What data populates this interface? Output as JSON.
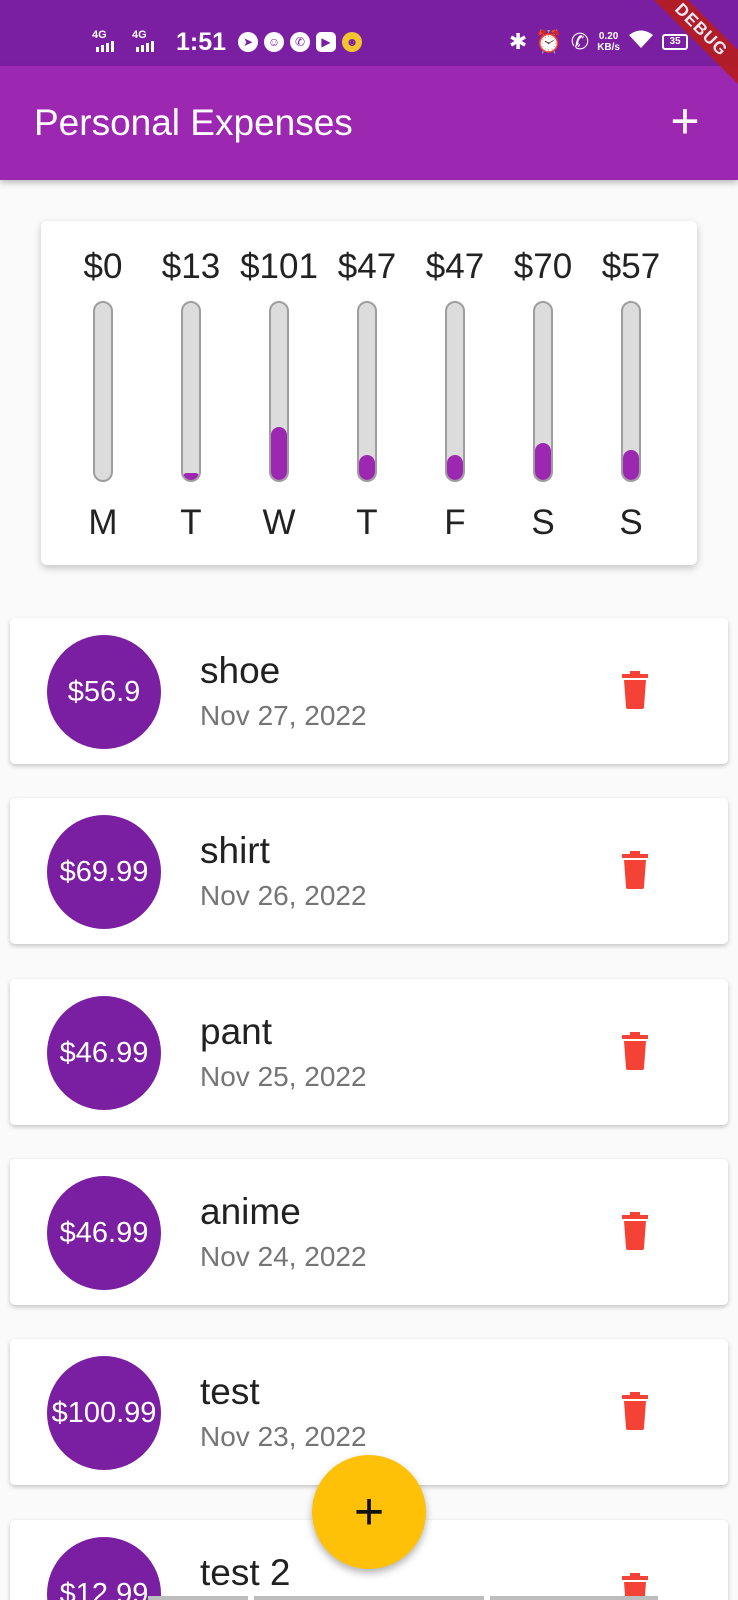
{
  "status_bar": {
    "net1": "4G",
    "net2": "4G",
    "time": "1:51",
    "speed_value": "0.20",
    "speed_unit": "KB/s",
    "battery": "35"
  },
  "debug_banner": "DEBUG",
  "app_bar": {
    "title": "Personal Expenses",
    "add_icon": "+"
  },
  "chart_data": {
    "type": "bar",
    "categories": [
      "M",
      "T",
      "W",
      "T",
      "F",
      "S",
      "S"
    ],
    "values": [
      0,
      13,
      101,
      47,
      47,
      70,
      57
    ],
    "labels": [
      "$0",
      "$13",
      "$101",
      "$47",
      "$47",
      "$70",
      "$57"
    ],
    "fill_fraction": [
      0.0,
      0.038,
      0.3,
      0.14,
      0.14,
      0.21,
      0.17
    ],
    "accent_color": "#9c27b0"
  },
  "transactions": [
    {
      "amount": "$56.9",
      "title": "shoe",
      "date": "Nov 27, 2022"
    },
    {
      "amount": "$69.99",
      "title": "shirt",
      "date": "Nov 26, 2022"
    },
    {
      "amount": "$46.99",
      "title": "pant",
      "date": "Nov 25, 2022"
    },
    {
      "amount": "$46.99",
      "title": "anime",
      "date": "Nov 24, 2022"
    },
    {
      "amount": "$100.99",
      "title": "test",
      "date": "Nov 23, 2022"
    },
    {
      "amount": "$12.99",
      "title": "test 2",
      "date": ""
    }
  ],
  "fab": {
    "icon": "+"
  },
  "colors": {
    "primary": "#9c27b0",
    "primary_dark": "#7b1fa2",
    "fab": "#ffc107",
    "delete": "#f44336"
  },
  "icons": {
    "delete": "trash-icon",
    "add": "plus-icon"
  }
}
